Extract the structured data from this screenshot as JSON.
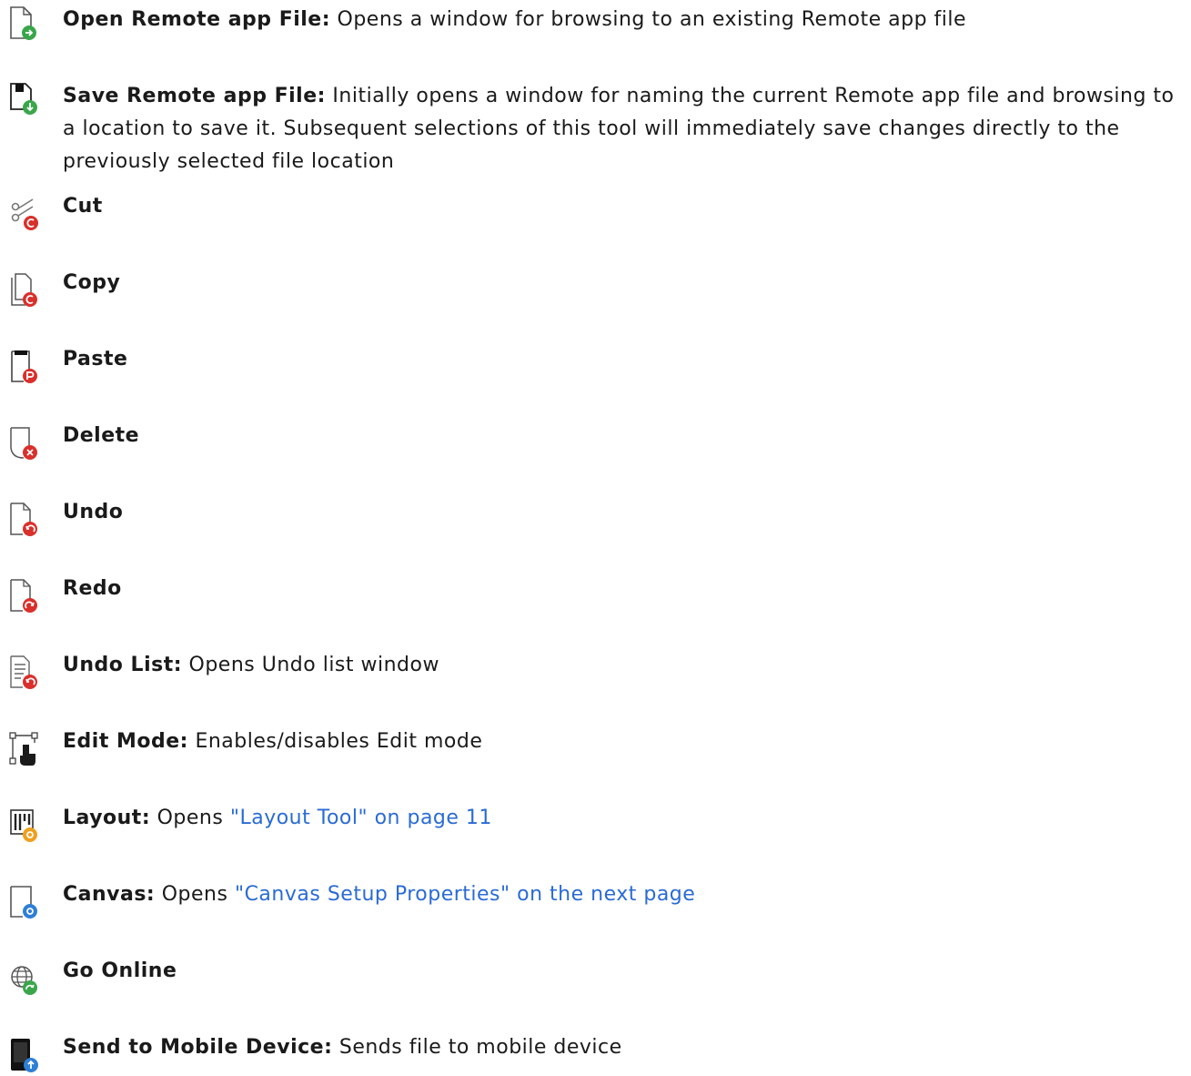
{
  "items": [
    {
      "term": "Open Remote app File:",
      "desc": " Opens a window for browsing to an existing Remote app file",
      "icon": "open-file-icon"
    },
    {
      "term": "Save Remote app File:",
      "desc": " Initially opens a window for naming the current Remote app file and browsing to a location to save it. Subsequent selections of this tool will immediately save changes directly to the previously selected file location",
      "icon": "save-file-icon"
    },
    {
      "term": "Cut",
      "icon": "cut-icon"
    },
    {
      "term": "Copy",
      "icon": "copy-icon"
    },
    {
      "term": "Paste",
      "icon": "paste-icon"
    },
    {
      "term": "Delete",
      "icon": "delete-icon"
    },
    {
      "term": "Undo",
      "icon": "undo-icon"
    },
    {
      "term": "Redo",
      "icon": "redo-icon"
    },
    {
      "term": "Undo List:",
      "desc": " Opens Undo list window",
      "icon": "undo-list-icon"
    },
    {
      "term": "Edit Mode:",
      "desc": " Enables/disables Edit mode",
      "icon": "edit-mode-icon"
    },
    {
      "term": "Layout:",
      "desc": " Opens ",
      "link": "\"Layout Tool\" on page 11",
      "icon": "layout-icon"
    },
    {
      "term": "Canvas:",
      "desc": " Opens ",
      "link": "\"Canvas Setup Properties\" on the next page",
      "icon": "canvas-icon"
    },
    {
      "term": "Go Online",
      "icon": "globe-icon"
    },
    {
      "term": "Send to Mobile Device:",
      "desc": " Sends file to mobile device",
      "icon": "mobile-device-icon"
    }
  ],
  "colors": {
    "link": "#2a6bd4",
    "green_badge": "#3aa64c",
    "red_badge": "#d9302c",
    "blue_badge": "#2f7fd6",
    "orange_badge": "#f0a020"
  }
}
